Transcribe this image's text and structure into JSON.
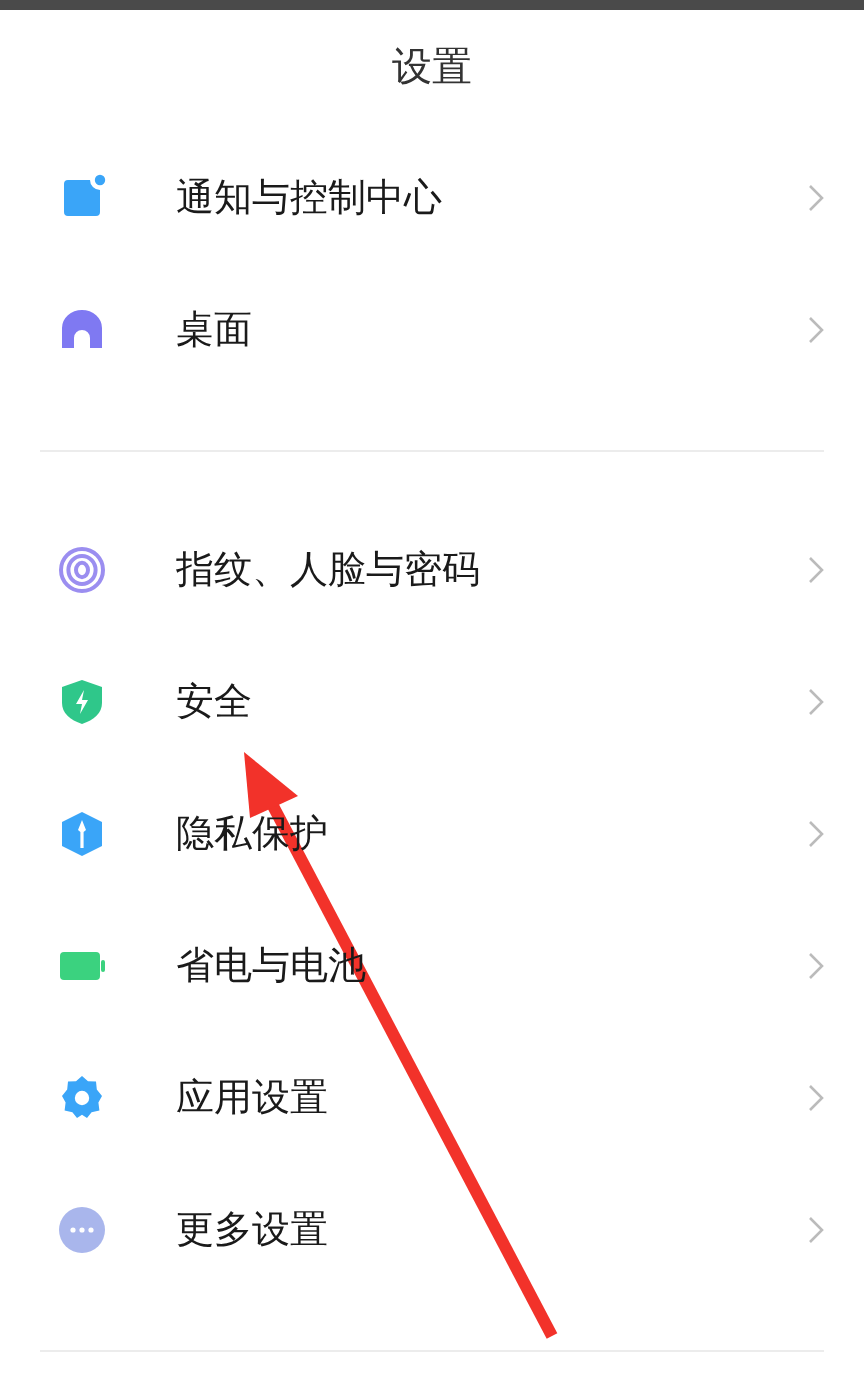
{
  "title": "设置",
  "groups": [
    {
      "items": [
        {
          "label": "通知与控制中心",
          "kind": "notification"
        },
        {
          "label": "桌面",
          "kind": "home"
        }
      ]
    },
    {
      "items": [
        {
          "label": "指纹、人脸与密码",
          "kind": "fingerprint"
        },
        {
          "label": "安全",
          "kind": "shield"
        },
        {
          "label": "隐私保护",
          "kind": "privacy"
        },
        {
          "label": "省电与电池",
          "kind": "battery"
        },
        {
          "label": "应用设置",
          "kind": "gear"
        },
        {
          "label": "更多设置",
          "kind": "more"
        }
      ]
    }
  ]
}
